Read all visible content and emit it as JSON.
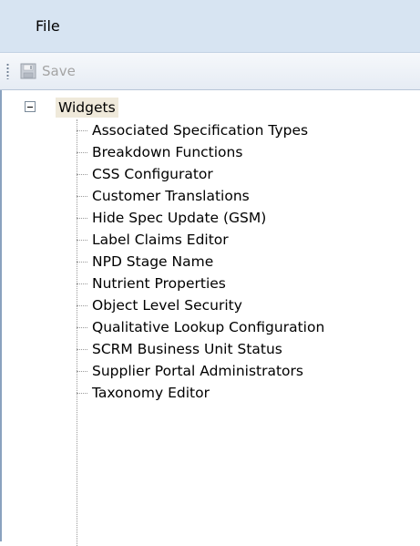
{
  "menu": {
    "file_label": "File"
  },
  "toolbar": {
    "save_label": "Save",
    "save_icon": "floppy-disk-icon"
  },
  "tree": {
    "root_label": "Widgets",
    "items": [
      "Associated Specification Types",
      "Breakdown Functions",
      "CSS Configurator",
      "Customer Translations",
      "Hide Spec Update (GSM)",
      "Label Claims Editor",
      "NPD Stage Name",
      "Nutrient Properties",
      "Object Level Security",
      "Qualitative Lookup Configuration",
      "SCRM Business Unit Status",
      "Supplier Portal Administrators",
      "Taxonomy Editor"
    ]
  }
}
